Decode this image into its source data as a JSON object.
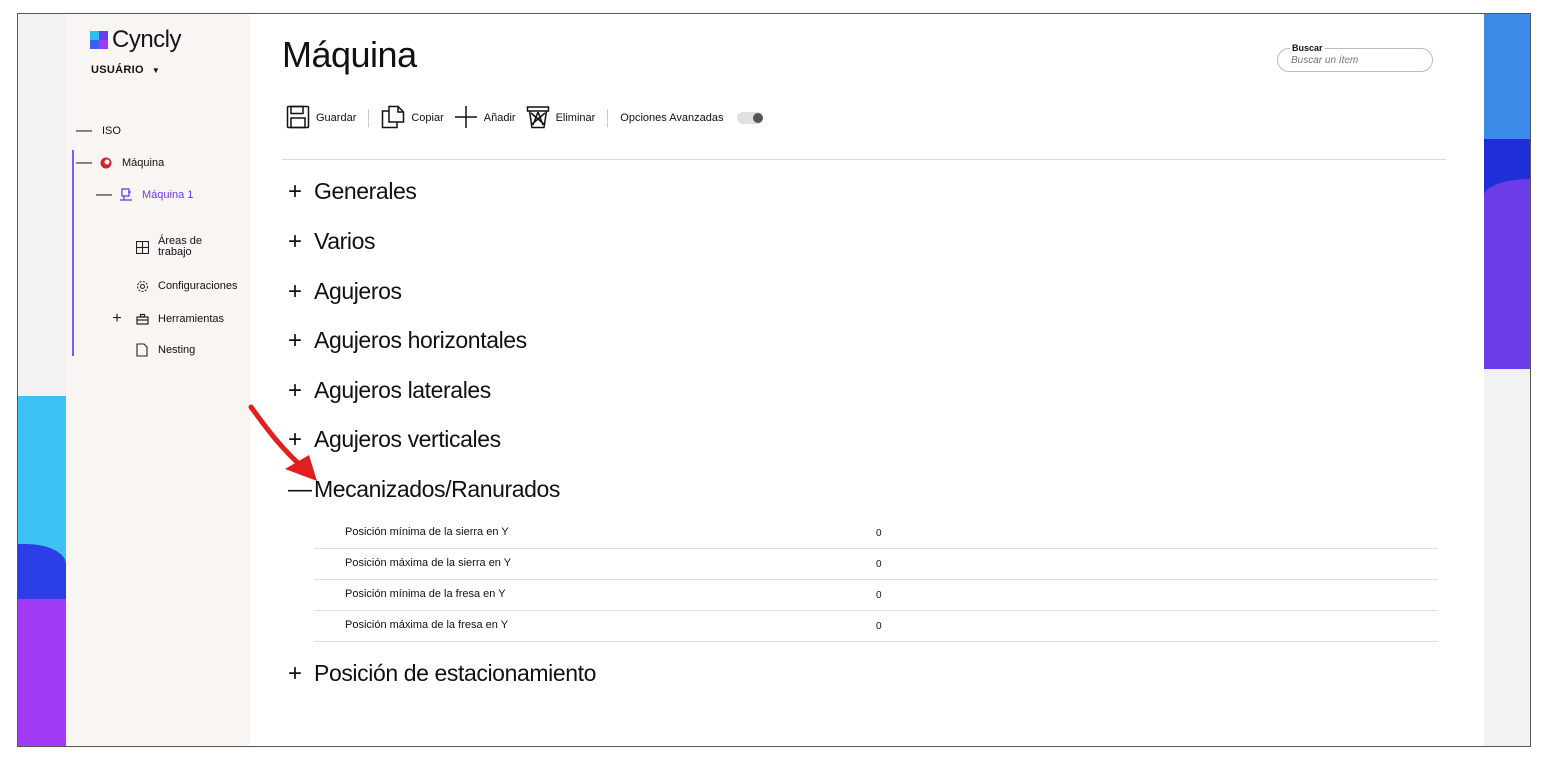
{
  "app": {
    "brand": "Cyncly",
    "user_menu": "USUÁRIO"
  },
  "sidebar": {
    "items": [
      {
        "label": "ISO",
        "toggle": "—"
      },
      {
        "label": "Máquina",
        "toggle": "—"
      },
      {
        "label": "Máquina 1",
        "toggle": "—"
      },
      {
        "label_line1": "Áreas de",
        "label_line2": "trabajo"
      },
      {
        "label": "Configuraciones"
      },
      {
        "label": "Herramientas",
        "toggle": "+"
      },
      {
        "label": "Nesting"
      }
    ]
  },
  "page": {
    "title": "Máquina"
  },
  "search": {
    "label": "Buscar",
    "placeholder": "Buscar un ítem"
  },
  "toolbar": {
    "save": "Guardar",
    "copy": "Copiar",
    "add": "Añadir",
    "delete": "Eliminar",
    "advanced": "Opciones Avanzadas",
    "advanced_on": false
  },
  "sections": [
    {
      "label": "Generales",
      "sign": "+"
    },
    {
      "label": "Varios",
      "sign": "+"
    },
    {
      "label": "Agujeros",
      "sign": "+"
    },
    {
      "label": "Agujeros horizontales",
      "sign": "+"
    },
    {
      "label": "Agujeros laterales",
      "sign": "+"
    },
    {
      "label": "Agujeros verticales",
      "sign": "+"
    },
    {
      "label": "Mecanizados/Ranurados",
      "sign": "—"
    },
    {
      "label": "Posición de estacionamiento",
      "sign": "+"
    }
  ],
  "mecanizados": [
    {
      "label": "Posición mínima de la sierra en Y",
      "value": "0"
    },
    {
      "label": "Posición máxima de la sierra en Y",
      "value": "0"
    },
    {
      "label": "Posición mínima de la fresa en Y",
      "value": "0"
    },
    {
      "label": "Posición máxima de la fresa en Y",
      "value": "0"
    }
  ],
  "colors": {
    "accent": "#7a5cf0",
    "annotation_arrow": "#e02020"
  }
}
